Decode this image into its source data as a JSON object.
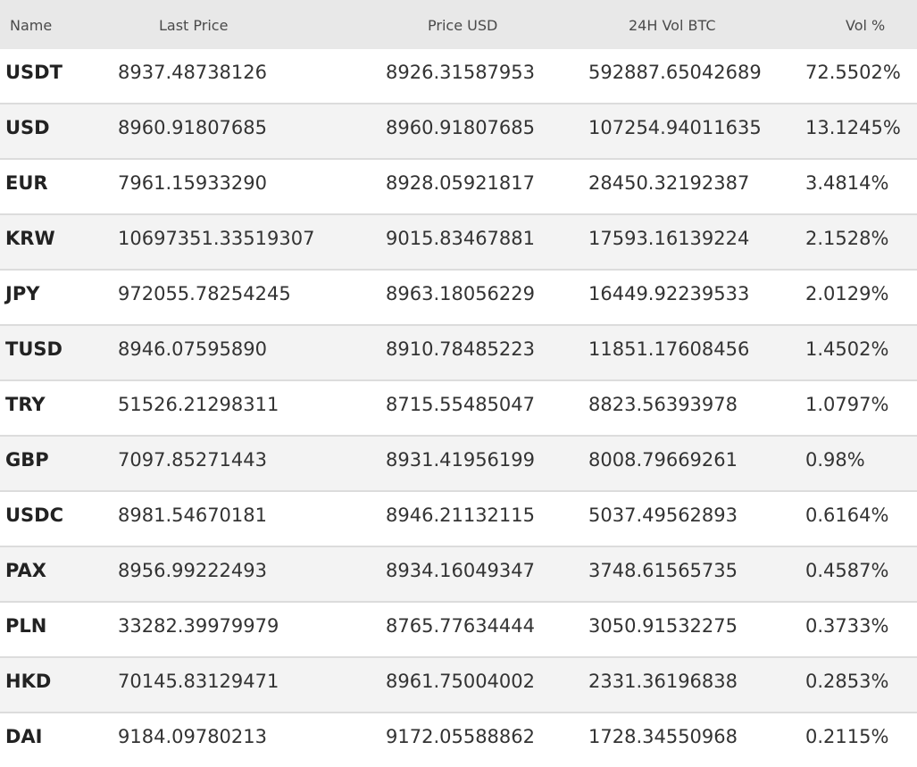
{
  "header": {
    "name": "Name",
    "last_price": "Last Price",
    "price_usd": "Price USD",
    "vol_btc": "24H Vol BTC",
    "vol_pct": "Vol %"
  },
  "rows": [
    {
      "name": "USDT",
      "last_price": "8937.48738126",
      "price_usd": "8926.31587953",
      "vol_btc": "592887.65042689",
      "vol_pct": "72.5502%"
    },
    {
      "name": "USD",
      "last_price": "8960.91807685",
      "price_usd": "8960.91807685",
      "vol_btc": "107254.94011635",
      "vol_pct": "13.1245%"
    },
    {
      "name": "EUR",
      "last_price": "7961.15933290",
      "price_usd": "8928.05921817",
      "vol_btc": "28450.32192387",
      "vol_pct": "3.4814%"
    },
    {
      "name": "KRW",
      "last_price": "10697351.33519307",
      "price_usd": "9015.83467881",
      "vol_btc": "17593.16139224",
      "vol_pct": "2.1528%"
    },
    {
      "name": "JPY",
      "last_price": "972055.78254245",
      "price_usd": "8963.18056229",
      "vol_btc": "16449.92239533",
      "vol_pct": "2.0129%"
    },
    {
      "name": "TUSD",
      "last_price": "8946.07595890",
      "price_usd": "8910.78485223",
      "vol_btc": "11851.17608456",
      "vol_pct": "1.4502%"
    },
    {
      "name": "TRY",
      "last_price": "51526.21298311",
      "price_usd": "8715.55485047",
      "vol_btc": "8823.56393978",
      "vol_pct": "1.0797%"
    },
    {
      "name": "GBP",
      "last_price": "7097.85271443",
      "price_usd": "8931.41956199",
      "vol_btc": "8008.79669261",
      "vol_pct": "0.98%"
    },
    {
      "name": "USDC",
      "last_price": "8981.54670181",
      "price_usd": "8946.21132115",
      "vol_btc": "5037.49562893",
      "vol_pct": "0.6164%"
    },
    {
      "name": "PAX",
      "last_price": "8956.99222493",
      "price_usd": "8934.16049347",
      "vol_btc": "3748.61565735",
      "vol_pct": "0.4587%"
    },
    {
      "name": "PLN",
      "last_price": "33282.39979979",
      "price_usd": "8765.77634444",
      "vol_btc": "3050.91532275",
      "vol_pct": "0.3733%"
    },
    {
      "name": "HKD",
      "last_price": "70145.83129471",
      "price_usd": "8961.75004002",
      "vol_btc": "2331.36196838",
      "vol_pct": "0.2853%"
    },
    {
      "name": "DAI",
      "last_price": "9184.09780213",
      "price_usd": "9172.05588862",
      "vol_btc": "1728.34550968",
      "vol_pct": "0.2115%"
    }
  ]
}
